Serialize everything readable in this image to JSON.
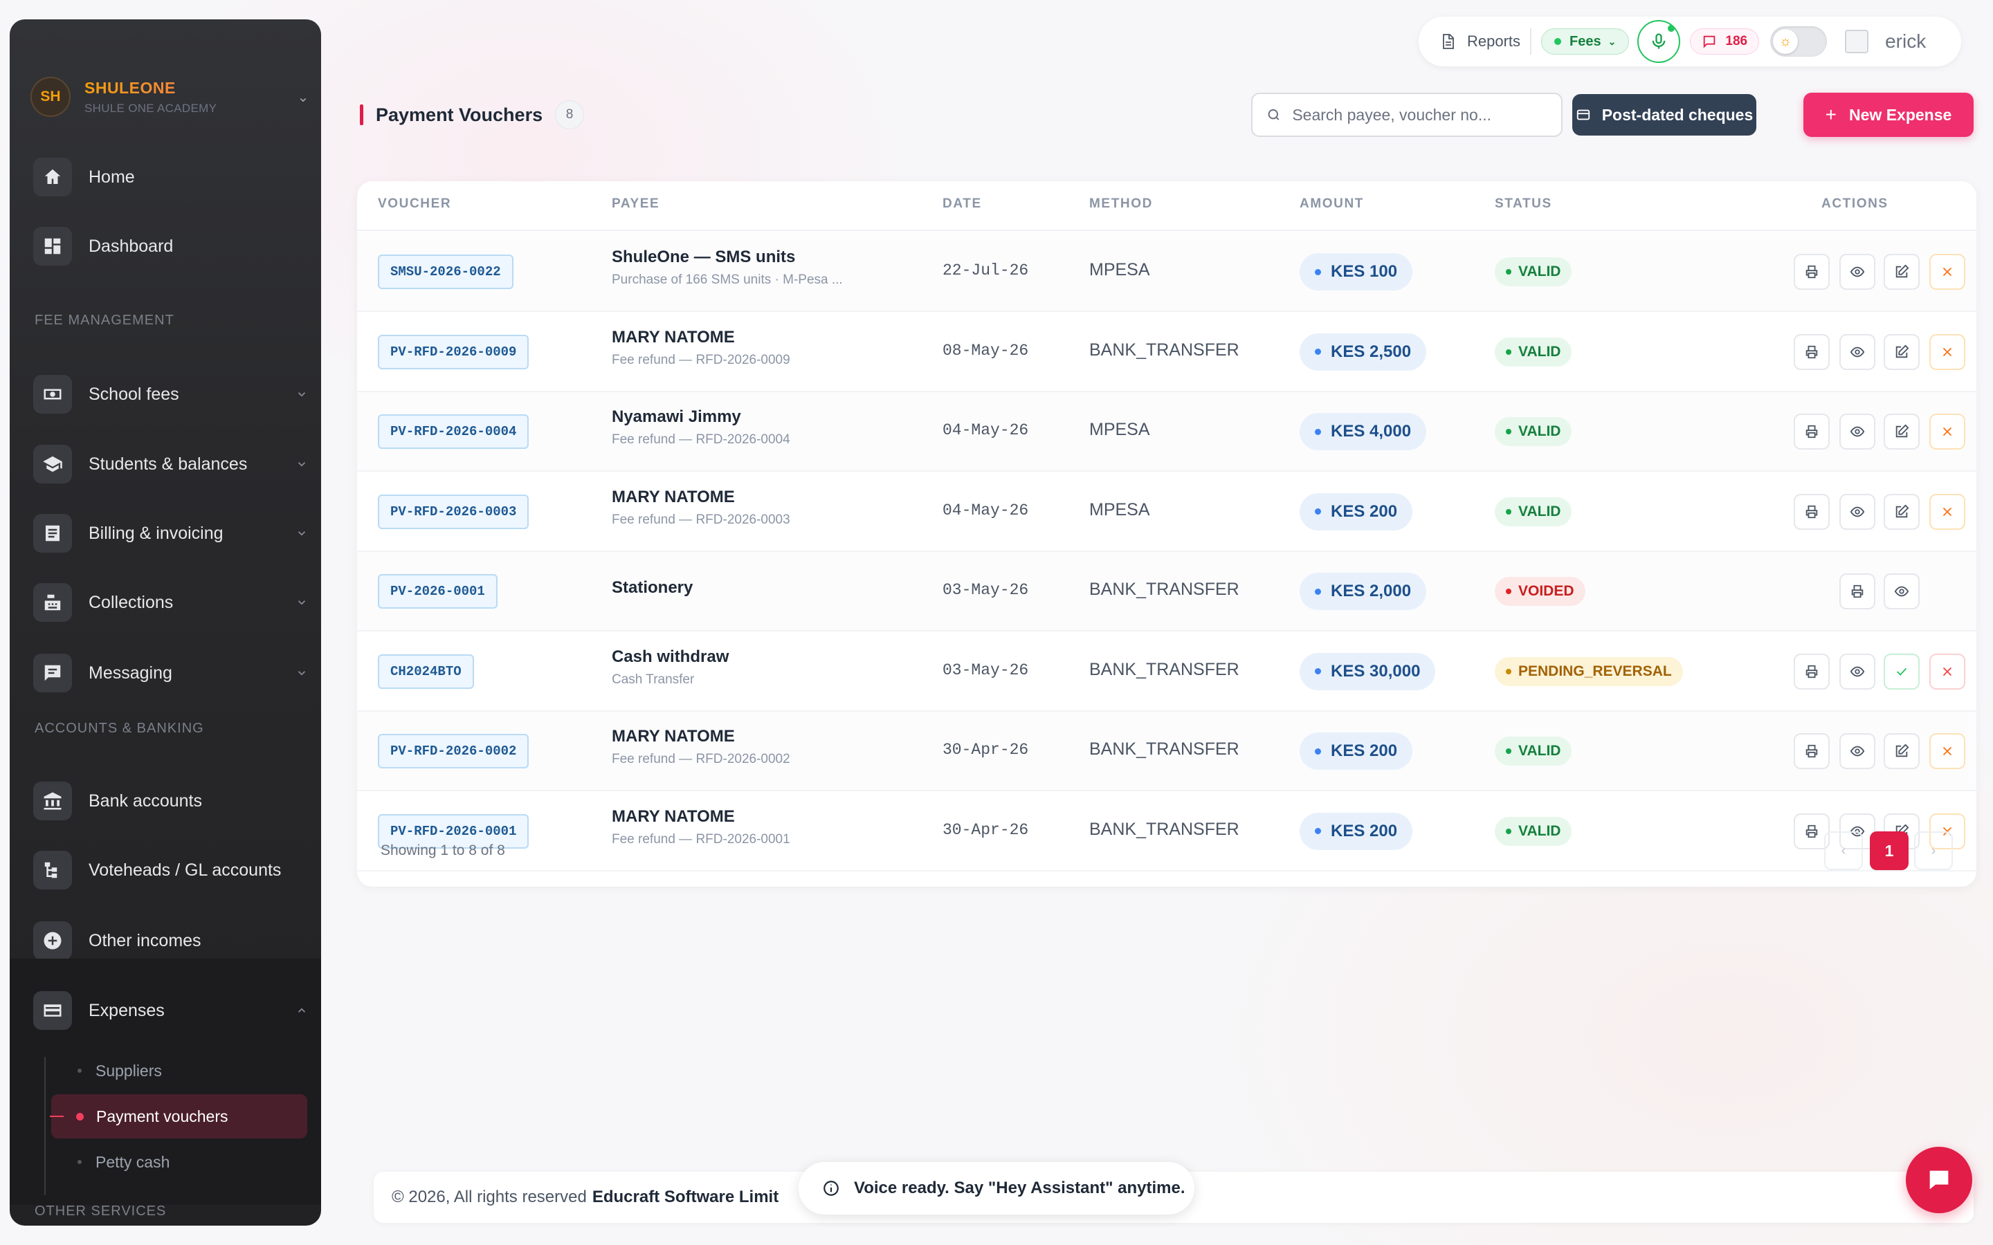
{
  "brand": {
    "initials": "SH",
    "name": "SHULEONE",
    "subtitle": "SHULE ONE ACADEMY"
  },
  "sidebar": {
    "items_top": [
      {
        "label": "Home",
        "icon": "home-icon"
      },
      {
        "label": "Dashboard",
        "icon": "dashboard-icon"
      }
    ],
    "section_fee": "FEE MANAGEMENT",
    "fee_items": [
      {
        "label": "School fees",
        "icon": "money-icon"
      },
      {
        "label": "Students & balances",
        "icon": "graduation-cap-icon"
      },
      {
        "label": "Billing & invoicing",
        "icon": "invoice-icon"
      },
      {
        "label": "Collections",
        "icon": "cash-register-icon"
      },
      {
        "label": "Messaging",
        "icon": "message-icon"
      }
    ],
    "section_accounts": "ACCOUNTS & BANKING",
    "account_items": [
      {
        "label": "Bank accounts",
        "icon": "bank-icon"
      },
      {
        "label": "Voteheads / GL accounts",
        "icon": "tree-icon"
      },
      {
        "label": "Other incomes",
        "icon": "plus-circle-icon"
      },
      {
        "label": "Expenses",
        "icon": "card-icon"
      }
    ],
    "expense_sub": [
      "Suppliers",
      "Payment vouchers",
      "Petty cash"
    ],
    "section_other": "OTHER SERVICES"
  },
  "topbar": {
    "reports": "Reports",
    "fees": "Fees",
    "messages_count": "186",
    "user": "erick"
  },
  "page": {
    "title": "Payment Vouchers",
    "count": "8"
  },
  "search": {
    "placeholder": "Search payee, voucher no..."
  },
  "buttons": {
    "postdated": "Post-dated cheques",
    "new_expense": "New Expense"
  },
  "table": {
    "headers": {
      "voucher": "VOUCHER",
      "payee": "PAYEE",
      "date": "DATE",
      "method": "METHOD",
      "amount": "AMOUNT",
      "status": "STATUS",
      "actions": "ACTIONS"
    },
    "rows": [
      {
        "voucher": "SMSU-2026-0022",
        "payee": "ShuleOne — SMS units",
        "sub": "Purchase of 166 SMS units · M-Pesa ...",
        "date": "22-Jul-26",
        "method": "MPESA",
        "amount": "KES 100",
        "status": "VALID"
      },
      {
        "voucher": "PV-RFD-2026-0009",
        "payee": "MARY NATOME",
        "sub": "Fee refund — RFD-2026-0009",
        "date": "08-May-26",
        "method": "BANK_TRANSFER",
        "amount": "KES 2,500",
        "status": "VALID"
      },
      {
        "voucher": "PV-RFD-2026-0004",
        "payee": "Nyamawi Jimmy",
        "sub": "Fee refund — RFD-2026-0004",
        "date": "04-May-26",
        "method": "MPESA",
        "amount": "KES 4,000",
        "status": "VALID"
      },
      {
        "voucher": "PV-RFD-2026-0003",
        "payee": "MARY NATOME",
        "sub": "Fee refund — RFD-2026-0003",
        "date": "04-May-26",
        "method": "MPESA",
        "amount": "KES 200",
        "status": "VALID"
      },
      {
        "voucher": "PV-2026-0001",
        "payee": "Stationery",
        "sub": "",
        "date": "03-May-26",
        "method": "BANK_TRANSFER",
        "amount": "KES 2,000",
        "status": "VOIDED"
      },
      {
        "voucher": "CH2024BTO",
        "payee": "Cash withdraw",
        "sub": "Cash Transfer",
        "date": "03-May-26",
        "method": "BANK_TRANSFER",
        "amount": "KES 30,000",
        "status": "PENDING_REVERSAL"
      },
      {
        "voucher": "PV-RFD-2026-0002",
        "payee": "MARY NATOME",
        "sub": "Fee refund — RFD-2026-0002",
        "date": "30-Apr-26",
        "method": "BANK_TRANSFER",
        "amount": "KES 200",
        "status": "VALID"
      },
      {
        "voucher": "PV-RFD-2026-0001",
        "payee": "MARY NATOME",
        "sub": "Fee refund — RFD-2026-0001",
        "date": "30-Apr-26",
        "method": "BANK_TRANSFER",
        "amount": "KES 200",
        "status": "VALID"
      }
    ],
    "showing": "Showing 1 to 8 of 8",
    "current_page": "1"
  },
  "footer": {
    "copyright": "© 2026, All rights reserved",
    "company": "Educraft Software Limit"
  },
  "toast": {
    "text": "Voice ready. Say \"Hey Assistant\" anytime."
  },
  "colors": {
    "accent": "#e11d48",
    "valid": "#15803d",
    "voided": "#c81e1e",
    "pending": "#a16207"
  }
}
